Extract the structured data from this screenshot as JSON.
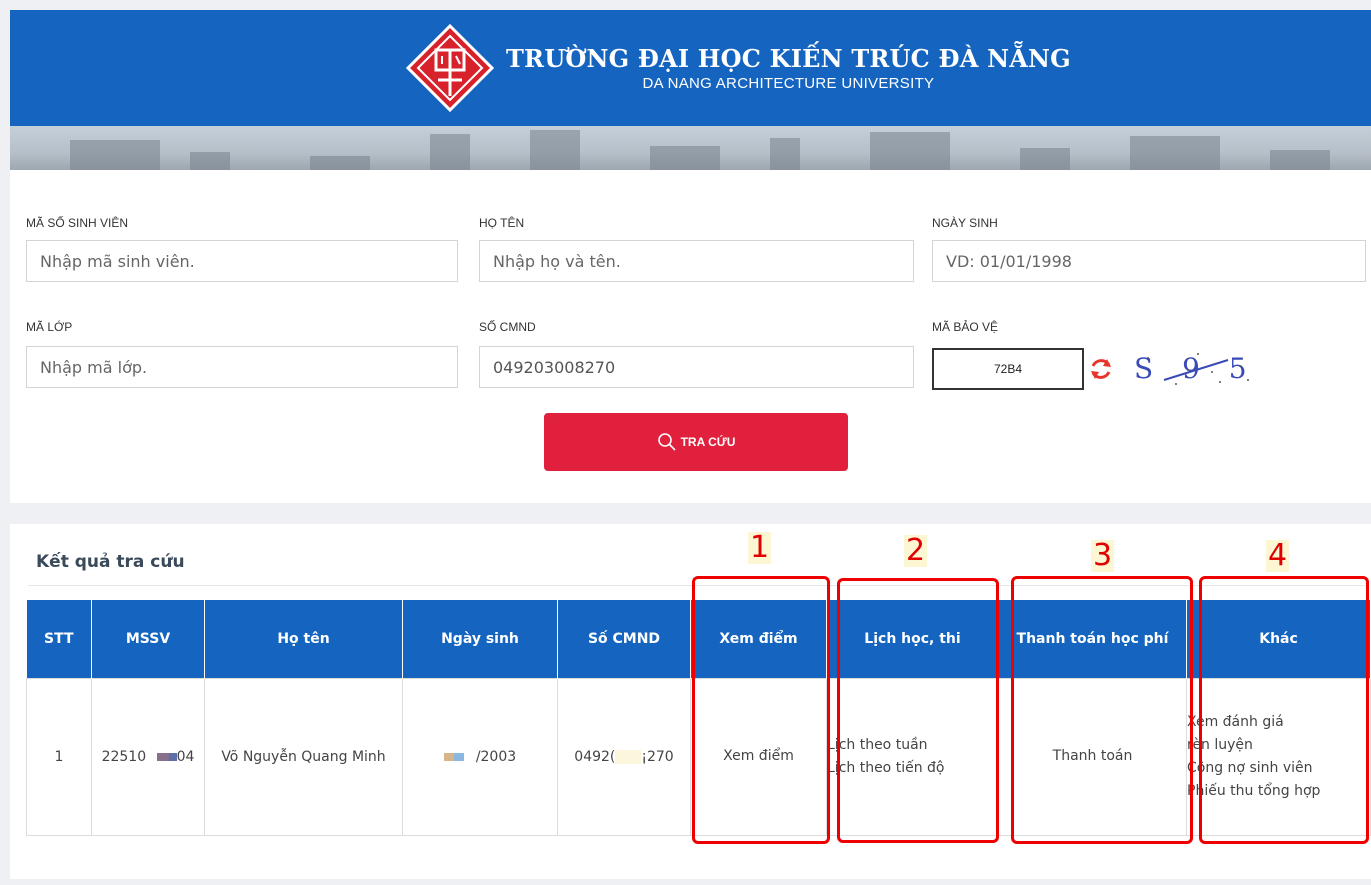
{
  "header": {
    "title_vn": "TRƯỜNG ĐẠI HỌC KIẾN TRÚC ĐÀ NẴNG",
    "title_en": "DA NANG ARCHITECTURE UNIVERSITY",
    "bg_color": "#1565c0"
  },
  "search": {
    "student_id": {
      "label": "MÃ SỐ SINH VIÊN",
      "placeholder": "Nhập mã sinh viên.",
      "value": ""
    },
    "full_name": {
      "label": "HỌ TÊN",
      "placeholder": "Nhập họ và tên.",
      "value": ""
    },
    "birthdate": {
      "label": "NGÀY SINH",
      "placeholder": "VD: 01/01/1998",
      "value": ""
    },
    "class_id": {
      "label": "MÃ LỚP",
      "placeholder": "Nhập mã lớp.",
      "value": ""
    },
    "id_card": {
      "label": "SỐ CMND",
      "placeholder": "",
      "value": "049203008270"
    },
    "captcha": {
      "label": "MÃ BẢO VỆ",
      "value": "72B4",
      "image_text": "S 9 5 5"
    },
    "submit_label": "TRA CỨU",
    "accent_color": "#e0203c"
  },
  "results": {
    "title": "Kết quả tra cứu",
    "columns": [
      "STT",
      "MSSV",
      "Họ tên",
      "Ngày sinh",
      "Số CMND",
      "Xem điểm",
      "Lịch học, thi",
      "Thanh toán học phí",
      "Khác"
    ],
    "rows": [
      {
        "stt": "1",
        "mssv_prefix": "22510",
        "mssv_suffix": "04",
        "name": "Võ Nguyễn Quang Minh",
        "birth_suffix": "/2003",
        "cmnd_prefix": "0492(",
        "cmnd_suffix": "¡270",
        "xem_diem": "Xem điểm",
        "lich_tuan": "Lịch theo tuần",
        "lich_tien_do": "Lịch theo tiến độ",
        "thanh_toan": "Thanh toán",
        "khac_1": "Xem đánh giá",
        "khac_2": "rèn luyện",
        "khac_3": "Công nợ sinh viên",
        "khac_4": "Phiếu thu tổng hợp"
      }
    ]
  },
  "annotations": [
    "1",
    "2",
    "3",
    "4"
  ]
}
